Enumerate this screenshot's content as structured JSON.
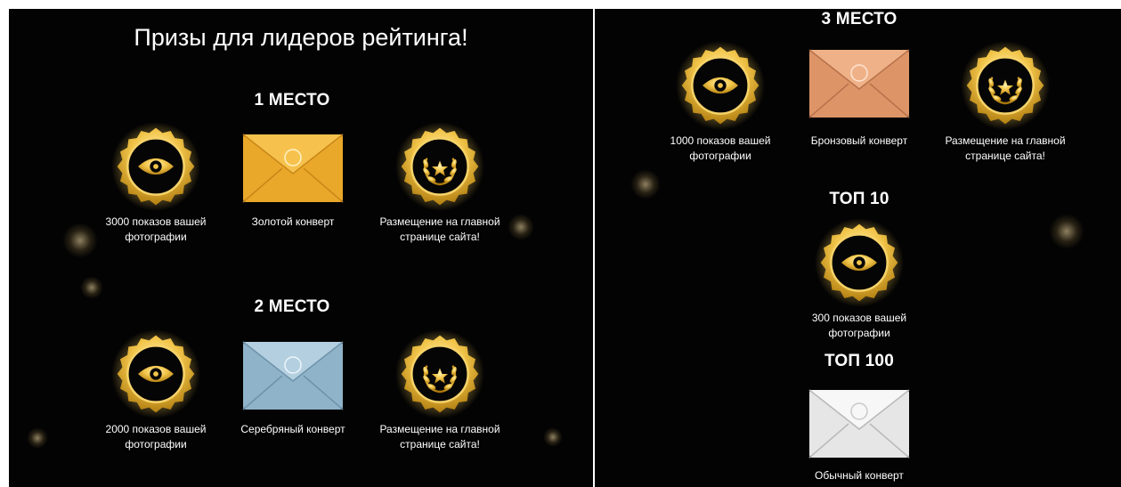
{
  "left": {
    "title": "Призы для лидеров рейтинга!",
    "place1": {
      "heading": "1 МЕСТО",
      "prizes": [
        {
          "label": "3000 показов вашей фотографии",
          "icon": "eye-badge-icon"
        },
        {
          "label": "Золотой конверт",
          "icon": "gold-envelope-icon",
          "color": "#e9a82a"
        },
        {
          "label": "Размещение на главной странице сайта!",
          "icon": "laurel-star-badge-icon"
        }
      ]
    },
    "place2": {
      "heading": "2 МЕСТО",
      "prizes": [
        {
          "label": "2000 показов вашей фотографии",
          "icon": "eye-badge-icon"
        },
        {
          "label": "Серебряный конверт",
          "icon": "silver-envelope-icon",
          "color": "#8fb3c9"
        },
        {
          "label": "Размещение на главной странице сайта!",
          "icon": "laurel-star-badge-icon"
        }
      ]
    }
  },
  "right": {
    "place3": {
      "heading": "3 МЕСТО",
      "prizes": [
        {
          "label": "1000 показов вашей фотографии",
          "icon": "eye-badge-icon"
        },
        {
          "label": "Бронзовый конверт",
          "icon": "bronze-envelope-icon",
          "color": "#dd9568"
        },
        {
          "label": "Размещение на главной странице сайта!",
          "icon": "laurel-star-badge-icon"
        }
      ]
    },
    "top10": {
      "heading": "ТОП 10",
      "prizes": [
        {
          "label": "300 показов вашей фотографии",
          "icon": "eye-badge-icon"
        }
      ]
    },
    "top100": {
      "heading": "ТОП 100",
      "prizes": [
        {
          "label": "Обычный конверт",
          "icon": "white-envelope-icon",
          "color": "#e6e6e6"
        }
      ]
    }
  },
  "colors": {
    "gold": "#f2c54a",
    "gold_dark": "#b8860b",
    "background": "#030303"
  }
}
